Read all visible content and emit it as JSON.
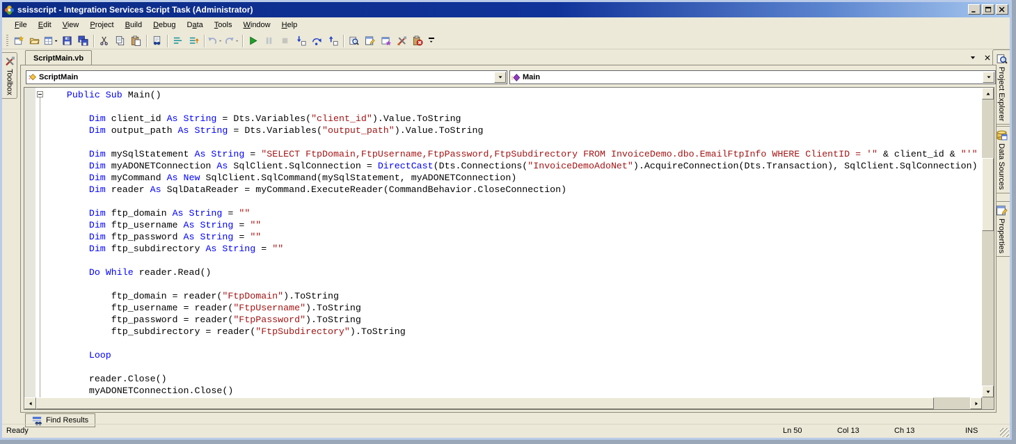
{
  "window": {
    "title": "ssisscript - Integration Services Script Task (Administrator)"
  },
  "menu": {
    "items": [
      {
        "label": "File",
        "underline": 0
      },
      {
        "label": "Edit",
        "underline": 0
      },
      {
        "label": "View",
        "underline": 0
      },
      {
        "label": "Project",
        "underline": 0
      },
      {
        "label": "Build",
        "underline": 0
      },
      {
        "label": "Debug",
        "underline": 0
      },
      {
        "label": "Data",
        "underline": 1
      },
      {
        "label": "Tools",
        "underline": 0
      },
      {
        "label": "Window",
        "underline": 0
      },
      {
        "label": "Help",
        "underline": 0
      }
    ]
  },
  "toolbar": {
    "buttons": [
      {
        "type": "grip"
      },
      {
        "name": "add-new-item"
      },
      {
        "name": "open-file"
      },
      {
        "name": "add-item",
        "dropdown": true
      },
      {
        "name": "save"
      },
      {
        "name": "save-all"
      },
      {
        "type": "sep"
      },
      {
        "name": "cut"
      },
      {
        "name": "copy"
      },
      {
        "name": "paste"
      },
      {
        "type": "sep"
      },
      {
        "name": "find-in-files"
      },
      {
        "type": "sep"
      },
      {
        "name": "comment-lines"
      },
      {
        "name": "uncomment-lines"
      },
      {
        "type": "sep"
      },
      {
        "name": "undo",
        "dropdown": true,
        "disabled": true
      },
      {
        "name": "redo",
        "dropdown": true,
        "disabled": true
      },
      {
        "type": "sep"
      },
      {
        "name": "start-debug"
      },
      {
        "name": "break-all",
        "disabled": true
      },
      {
        "name": "stop-debug",
        "disabled": true
      },
      {
        "name": "step-into"
      },
      {
        "name": "step-over"
      },
      {
        "name": "step-out"
      },
      {
        "type": "sep"
      },
      {
        "name": "solution-explorer"
      },
      {
        "name": "properties-window"
      },
      {
        "name": "object-browser"
      },
      {
        "name": "toolbox-window"
      },
      {
        "name": "error-list"
      },
      {
        "type": "overflow"
      }
    ]
  },
  "document": {
    "tab_label": "ScriptMain.vb"
  },
  "navbar": {
    "types_label": "ScriptMain",
    "members_label": "Main"
  },
  "panels": {
    "left": [
      {
        "label": "Toolbox",
        "icon": "toolbox-icon"
      }
    ],
    "right": [
      {
        "label": "Project Explorer",
        "icon": "project-explorer-icon",
        "group": 1
      },
      {
        "label": "Data Sources",
        "icon": "data-sources-icon",
        "group": 1
      },
      {
        "label": "Properties",
        "icon": "properties-icon",
        "group": 2
      }
    ],
    "bottom": [
      {
        "label": "Find Results",
        "icon": "find-results-icon"
      }
    ]
  },
  "code": {
    "lines": [
      [
        [
          "p",
          "    "
        ],
        [
          "k",
          "Public"
        ],
        [
          "p",
          " "
        ],
        [
          "k",
          "Sub"
        ],
        [
          "p",
          " Main()"
        ]
      ],
      [],
      [
        [
          "p",
          "        "
        ],
        [
          "k",
          "Dim"
        ],
        [
          "p",
          " client_id "
        ],
        [
          "k",
          "As"
        ],
        [
          "p",
          " "
        ],
        [
          "k",
          "String"
        ],
        [
          "p",
          " = Dts.Variables("
        ],
        [
          "s",
          "\"client_id\""
        ],
        [
          "p",
          ").Value.ToString"
        ]
      ],
      [
        [
          "p",
          "        "
        ],
        [
          "k",
          "Dim"
        ],
        [
          "p",
          " output_path "
        ],
        [
          "k",
          "As"
        ],
        [
          "p",
          " "
        ],
        [
          "k",
          "String"
        ],
        [
          "p",
          " = Dts.Variables("
        ],
        [
          "s",
          "\"output_path\""
        ],
        [
          "p",
          ").Value.ToString"
        ]
      ],
      [],
      [
        [
          "p",
          "        "
        ],
        [
          "k",
          "Dim"
        ],
        [
          "p",
          " mySqlStatement "
        ],
        [
          "k",
          "As"
        ],
        [
          "p",
          " "
        ],
        [
          "k",
          "String"
        ],
        [
          "p",
          " = "
        ],
        [
          "s",
          "\"SELECT FtpDomain,FtpUsername,FtpPassword,FtpSubdirectory FROM InvoiceDemo.dbo.EmailFtpInfo WHERE ClientID = '\""
        ],
        [
          "p",
          " & client_id & "
        ],
        [
          "s",
          "\"'\""
        ]
      ],
      [
        [
          "p",
          "        "
        ],
        [
          "k",
          "Dim"
        ],
        [
          "p",
          " myADONETConnection "
        ],
        [
          "k",
          "As"
        ],
        [
          "p",
          " SqlClient.SqlConnection = "
        ],
        [
          "k",
          "DirectCast"
        ],
        [
          "p",
          "(Dts.Connections("
        ],
        [
          "s",
          "\"InvoiceDemoAdoNet\""
        ],
        [
          "p",
          ").AcquireConnection(Dts.Transaction), SqlClient.SqlConnection)"
        ]
      ],
      [
        [
          "p",
          "        "
        ],
        [
          "k",
          "Dim"
        ],
        [
          "p",
          " myCommand "
        ],
        [
          "k",
          "As"
        ],
        [
          "p",
          " "
        ],
        [
          "k",
          "New"
        ],
        [
          "p",
          " SqlClient.SqlCommand(mySqlStatement, myADONETConnection)"
        ]
      ],
      [
        [
          "p",
          "        "
        ],
        [
          "k",
          "Dim"
        ],
        [
          "p",
          " reader "
        ],
        [
          "k",
          "As"
        ],
        [
          "p",
          " SqlDataReader = myCommand.ExecuteReader(CommandBehavior.CloseConnection)"
        ]
      ],
      [],
      [
        [
          "p",
          "        "
        ],
        [
          "k",
          "Dim"
        ],
        [
          "p",
          " ftp_domain "
        ],
        [
          "k",
          "As"
        ],
        [
          "p",
          " "
        ],
        [
          "k",
          "String"
        ],
        [
          "p",
          " = "
        ],
        [
          "s",
          "\"\""
        ]
      ],
      [
        [
          "p",
          "        "
        ],
        [
          "k",
          "Dim"
        ],
        [
          "p",
          " ftp_username "
        ],
        [
          "k",
          "As"
        ],
        [
          "p",
          " "
        ],
        [
          "k",
          "String"
        ],
        [
          "p",
          " = "
        ],
        [
          "s",
          "\"\""
        ]
      ],
      [
        [
          "p",
          "        "
        ],
        [
          "k",
          "Dim"
        ],
        [
          "p",
          " ftp_password "
        ],
        [
          "k",
          "As"
        ],
        [
          "p",
          " "
        ],
        [
          "k",
          "String"
        ],
        [
          "p",
          " = "
        ],
        [
          "s",
          "\"\""
        ]
      ],
      [
        [
          "p",
          "        "
        ],
        [
          "k",
          "Dim"
        ],
        [
          "p",
          " ftp_subdirectory "
        ],
        [
          "k",
          "As"
        ],
        [
          "p",
          " "
        ],
        [
          "k",
          "String"
        ],
        [
          "p",
          " = "
        ],
        [
          "s",
          "\"\""
        ]
      ],
      [],
      [
        [
          "p",
          "        "
        ],
        [
          "k",
          "Do"
        ],
        [
          "p",
          " "
        ],
        [
          "k",
          "While"
        ],
        [
          "p",
          " reader.Read()"
        ]
      ],
      [],
      [
        [
          "p",
          "            ftp_domain = reader("
        ],
        [
          "s",
          "\"FtpDomain\""
        ],
        [
          "p",
          ").ToString"
        ]
      ],
      [
        [
          "p",
          "            ftp_username = reader("
        ],
        [
          "s",
          "\"FtpUsername\""
        ],
        [
          "p",
          ").ToString"
        ]
      ],
      [
        [
          "p",
          "            ftp_password = reader("
        ],
        [
          "s",
          "\"FtpPassword\""
        ],
        [
          "p",
          ").ToString"
        ]
      ],
      [
        [
          "p",
          "            ftp_subdirectory = reader("
        ],
        [
          "s",
          "\"FtpSubdirectory\""
        ],
        [
          "p",
          ").ToString"
        ]
      ],
      [],
      [
        [
          "p",
          "        "
        ],
        [
          "k",
          "Loop"
        ]
      ],
      [],
      [
        [
          "p",
          "        reader.Close()"
        ]
      ],
      [
        [
          "p",
          "        myADONETConnection.Close()"
        ]
      ]
    ]
  },
  "statusbar": {
    "ready": "Ready",
    "line": "Ln 50",
    "column": "Col 13",
    "char": "Ch 13",
    "mode": "INS"
  },
  "colors": {
    "keyword": "#0000ff",
    "string": "#a31515",
    "titlebar": "#0c2c86",
    "chrome": "#ece9d8"
  }
}
